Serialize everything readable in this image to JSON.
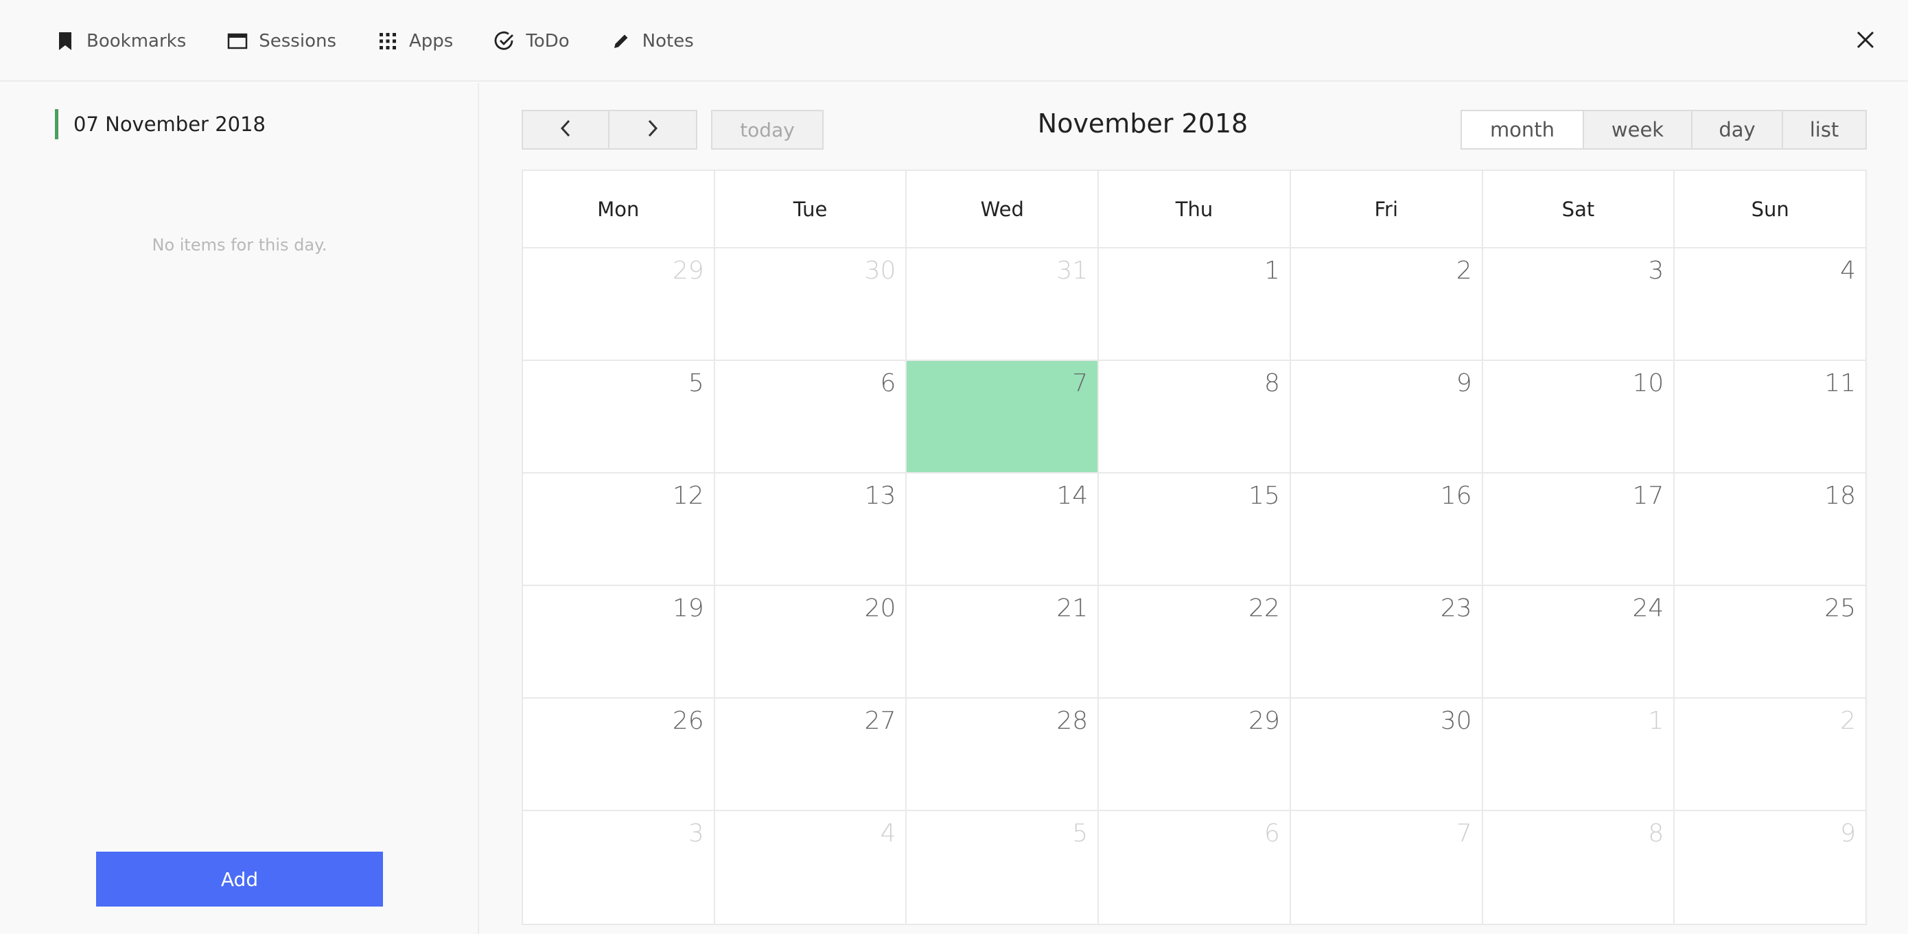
{
  "nav": {
    "items": [
      {
        "label": "Bookmarks",
        "icon": "bookmark-icon"
      },
      {
        "label": "Sessions",
        "icon": "window-icon"
      },
      {
        "label": "Apps",
        "icon": "grid-icon"
      },
      {
        "label": "ToDo",
        "icon": "check-circle-icon"
      },
      {
        "label": "Notes",
        "icon": "pencil-icon"
      }
    ],
    "close_icon": "close-icon"
  },
  "sidebar": {
    "selected_date": "07 November 2018",
    "empty_message": "No items for this day.",
    "add_label": "Add",
    "accent_color": "#4b9e5c",
    "add_color": "#4a6cf7"
  },
  "calendar": {
    "title": "November 2018",
    "prev_icon": "chevron-left-icon",
    "next_icon": "chevron-right-icon",
    "today_label": "today",
    "views": [
      {
        "label": "month",
        "active": true
      },
      {
        "label": "week",
        "active": false
      },
      {
        "label": "day",
        "active": false
      },
      {
        "label": "list",
        "active": false
      }
    ],
    "weekdays": [
      "Mon",
      "Tue",
      "Wed",
      "Thu",
      "Fri",
      "Sat",
      "Sun"
    ],
    "today_color": "#99e2b8",
    "weeks": [
      [
        {
          "n": "29",
          "other": true
        },
        {
          "n": "30",
          "other": true
        },
        {
          "n": "31",
          "other": true
        },
        {
          "n": "1"
        },
        {
          "n": "2"
        },
        {
          "n": "3"
        },
        {
          "n": "4"
        }
      ],
      [
        {
          "n": "5"
        },
        {
          "n": "6"
        },
        {
          "n": "7",
          "today": true
        },
        {
          "n": "8"
        },
        {
          "n": "9"
        },
        {
          "n": "10"
        },
        {
          "n": "11"
        }
      ],
      [
        {
          "n": "12"
        },
        {
          "n": "13"
        },
        {
          "n": "14"
        },
        {
          "n": "15"
        },
        {
          "n": "16"
        },
        {
          "n": "17"
        },
        {
          "n": "18"
        }
      ],
      [
        {
          "n": "19"
        },
        {
          "n": "20"
        },
        {
          "n": "21"
        },
        {
          "n": "22"
        },
        {
          "n": "23"
        },
        {
          "n": "24"
        },
        {
          "n": "25"
        }
      ],
      [
        {
          "n": "26"
        },
        {
          "n": "27"
        },
        {
          "n": "28"
        },
        {
          "n": "29"
        },
        {
          "n": "30"
        },
        {
          "n": "1",
          "other": true
        },
        {
          "n": "2",
          "other": true
        }
      ],
      [
        {
          "n": "3",
          "other": true
        },
        {
          "n": "4",
          "other": true
        },
        {
          "n": "5",
          "other": true
        },
        {
          "n": "6",
          "other": true
        },
        {
          "n": "7",
          "other": true
        },
        {
          "n": "8",
          "other": true
        },
        {
          "n": "9",
          "other": true
        }
      ]
    ]
  }
}
